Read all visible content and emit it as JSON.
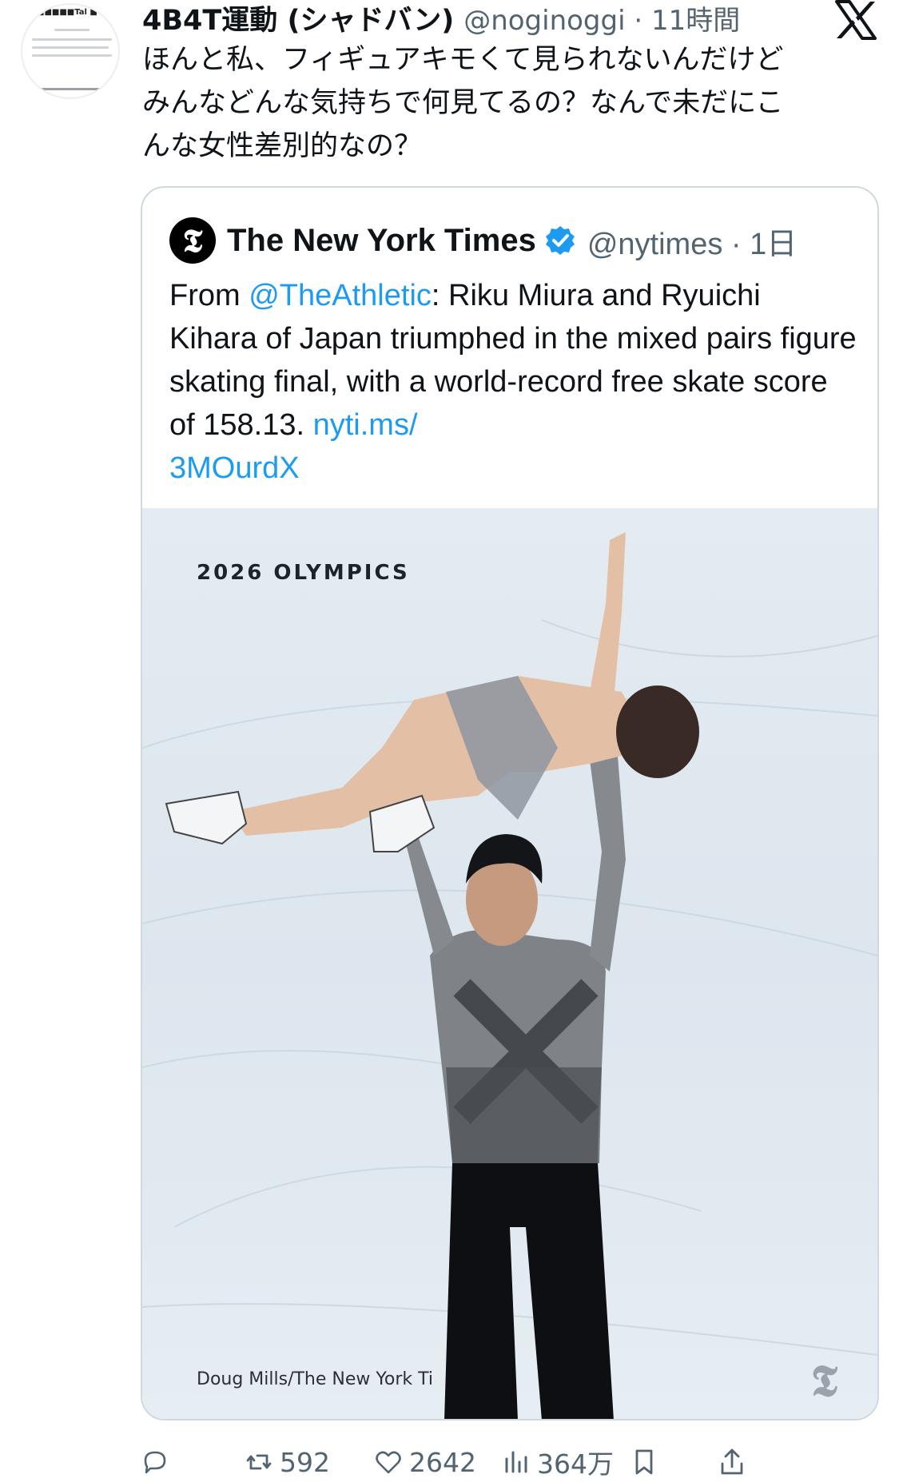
{
  "tweet": {
    "author_name": "4B4T運動 (シャドバン)",
    "author_handle": "@noginoggi · 11時間",
    "text": "ほんと私、フィギュアキモくて見られないんだけど\nみんなどんな気持ちで何見てるの？なんで未だにこ\nんな女性差別的なの？",
    "avatar_title": "■■■■■Tal ■"
  },
  "quote": {
    "name": "The New York Times",
    "handle": "@nytimes · 1日",
    "logo_letter": "𝕿",
    "text_before": "From ",
    "mention": "@TheAthletic",
    "text_middle": ": Riku Miura and Ryuichi Kihara of Japan triumphed in the mixed pairs figure skating final, with a world-record free skate score of 158.13. ",
    "link_part1": "nyti.ms/",
    "link_part2": "3MOurdX",
    "photo_label": "2026 OLYMPICS",
    "photo_credit": "Doug Mills/The New York Ti",
    "watermark": "𝕿"
  },
  "actions": {
    "retweets": "592",
    "likes": "2642",
    "views": "364万"
  },
  "colors": {
    "accent": "#1d9bf0",
    "secondary_text": "#536471",
    "border": "#cfd9de"
  }
}
